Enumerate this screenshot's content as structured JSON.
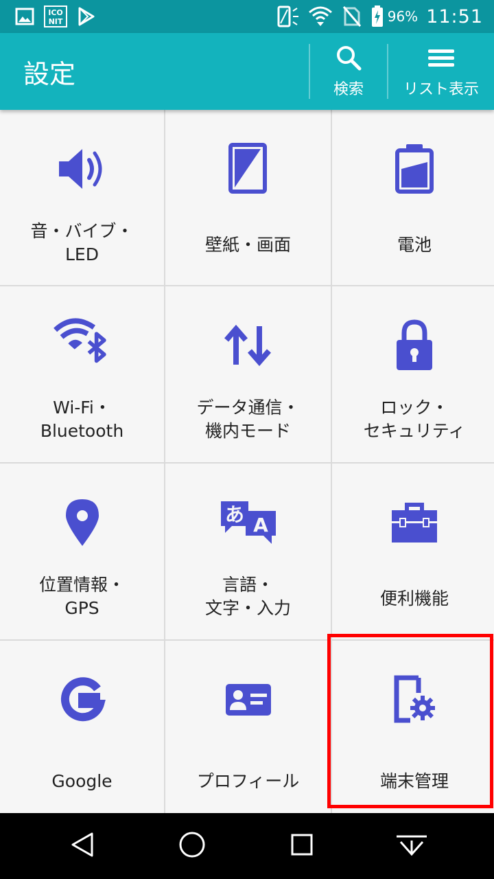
{
  "status_bar": {
    "battery_percent": "96%",
    "time": "11:51"
  },
  "app_bar": {
    "title": "設定",
    "search_label": "検索",
    "list_label": "リスト表示"
  },
  "tiles": [
    {
      "lines": [
        "音・バイブ・",
        "LED"
      ],
      "icon": "speaker-icon"
    },
    {
      "lines": [
        "壁紙・画面"
      ],
      "icon": "display-icon"
    },
    {
      "lines": [
        "電池"
      ],
      "icon": "battery-icon"
    },
    {
      "lines": [
        "Wi-Fi・",
        "Bluetooth"
      ],
      "icon": "wifi-bluetooth-icon"
    },
    {
      "lines": [
        "データ通信・",
        "機内モード"
      ],
      "icon": "data-transfer-icon"
    },
    {
      "lines": [
        "ロック・",
        "セキュリティ"
      ],
      "icon": "lock-icon"
    },
    {
      "lines": [
        "位置情報・",
        "GPS"
      ],
      "icon": "location-pin-icon"
    },
    {
      "lines": [
        "言語・",
        "文字・入力"
      ],
      "icon": "language-icon"
    },
    {
      "lines": [
        "便利機能"
      ],
      "icon": "toolbox-icon"
    },
    {
      "lines": [
        "Google"
      ],
      "icon": "google-icon"
    },
    {
      "lines": [
        "プロフィール"
      ],
      "icon": "profile-card-icon"
    },
    {
      "lines": [
        "端末管理"
      ],
      "icon": "device-settings-icon"
    }
  ],
  "colors": {
    "status_bar": "#0c959f",
    "app_bar": "#13b3bd",
    "icon": "#4a4fcf",
    "highlight": "#ff0000"
  }
}
